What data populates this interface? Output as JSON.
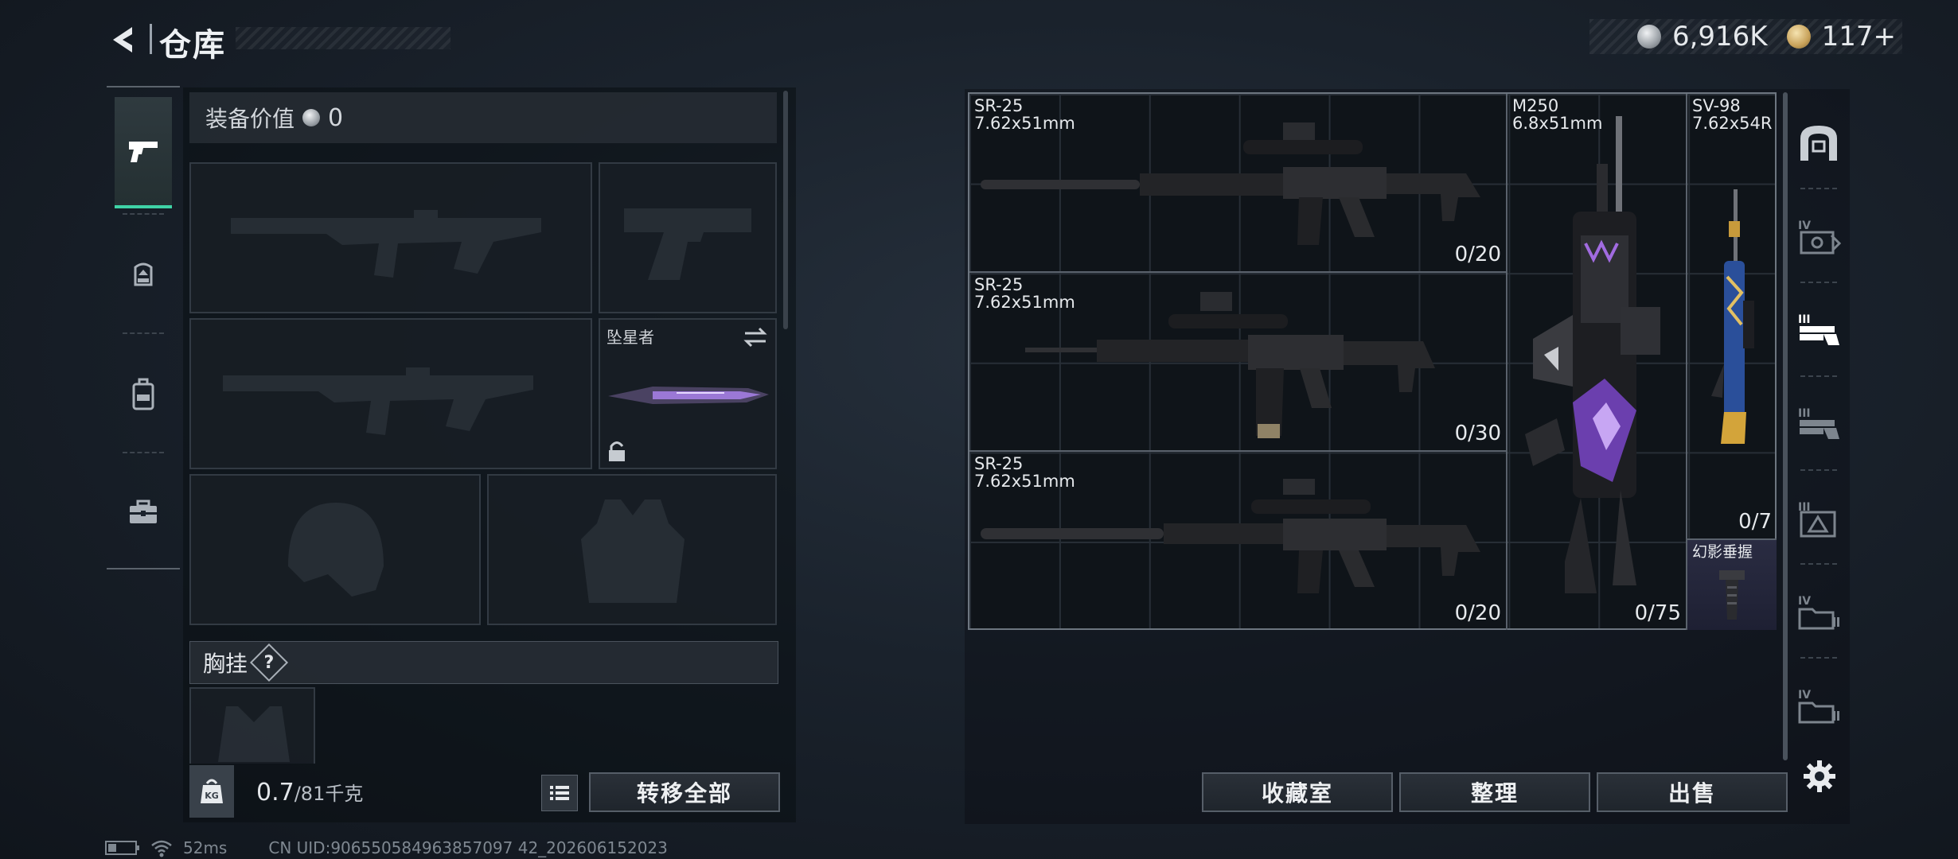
{
  "header": {
    "title": "仓库"
  },
  "currency": {
    "silver_value": "6,916K",
    "gold_value": "117+"
  },
  "left_rail": {
    "tabs": [
      "pistol-icon",
      "backpack-helmet-icon",
      "backpack-icon",
      "toolbox-icon"
    ],
    "active_index": 0
  },
  "equipment": {
    "header_label": "装备价值",
    "header_value": "0",
    "melee_slot": {
      "name": "坠星者"
    },
    "chest_rig_label": "胸挂",
    "help_glyph": "?"
  },
  "bottom": {
    "weight_current": "0.7",
    "weight_max": "/81千克",
    "transfer_all": "转移全部",
    "collection_room": "收藏室",
    "organize": "整理",
    "sell": "出售"
  },
  "storage_items": [
    {
      "name": "SR-25\n7.62x51mm",
      "ammo": "0/20"
    },
    {
      "name": "SR-25\n7.62x51mm",
      "ammo": "0/30"
    },
    {
      "name": "SR-25\n7.62x51mm",
      "ammo": "0/20"
    },
    {
      "name": "M250\n6.8x51mm",
      "ammo": "0/75"
    },
    {
      "name": "SV-98\n7.62x54R",
      "ammo": "0/7"
    },
    {
      "name": "幻影垂握",
      "ammo": ""
    }
  ],
  "right_rail": {
    "tabs": [
      "safe-icon",
      "container-iv-icon",
      "container-iii-icon-active",
      "container-iii-icon",
      "container-iii-alert-icon",
      "folder-iv-icon",
      "folder-iv-icon-2"
    ]
  },
  "status": {
    "ping": "52ms",
    "uid": "CN UID:906550584963857097 42_202606152023"
  },
  "colors": {
    "accent_active": "#3fd3a6",
    "purple_skin": "#8a4fd0"
  }
}
